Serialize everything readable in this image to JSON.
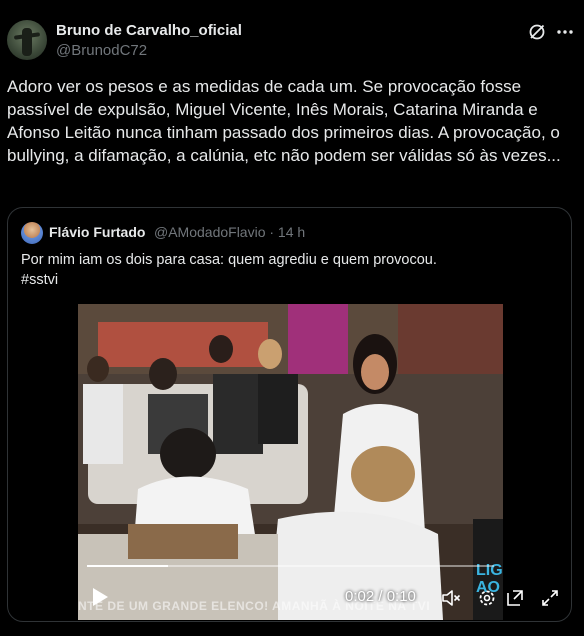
{
  "author": {
    "display_name": "Bruno de Carvalho_oficial",
    "handle": "@BrunodC72"
  },
  "icons": {
    "grok": "grok-icon",
    "more": "more-icon"
  },
  "tweet": {
    "text": "Adoro ver os pesos e as medidas de cada um. Se provocação fosse passível de expulsão, Miguel Vicente, Inês Morais, Catarina Miranda e Afonso Leitão nunca tinham passado dos primeiros dias. A provocação, o bullying, a difamação, a calúnia, etc não podem ser válidas só às vezes..."
  },
  "quote": {
    "display_name": "Flávio Furtado",
    "handle_time": "@AModadoFlavio · 14 h",
    "text_line1": "Por mim iam os dois para casa: quem agrediu e quem provocou.",
    "text_line2": "#sstvi"
  },
  "video": {
    "time": "0:02 / 0:10",
    "progress": 0.2,
    "caption": "NTE DE UM GRANDE ELENCO! AMANHÃ À NOITE NA TVI",
    "brand_line1": "LIG",
    "brand_line2": "AO"
  },
  "colors": {
    "background": "#000000",
    "text": "#e7e9ea",
    "secondary": "#71767b",
    "border": "#2f3336"
  }
}
